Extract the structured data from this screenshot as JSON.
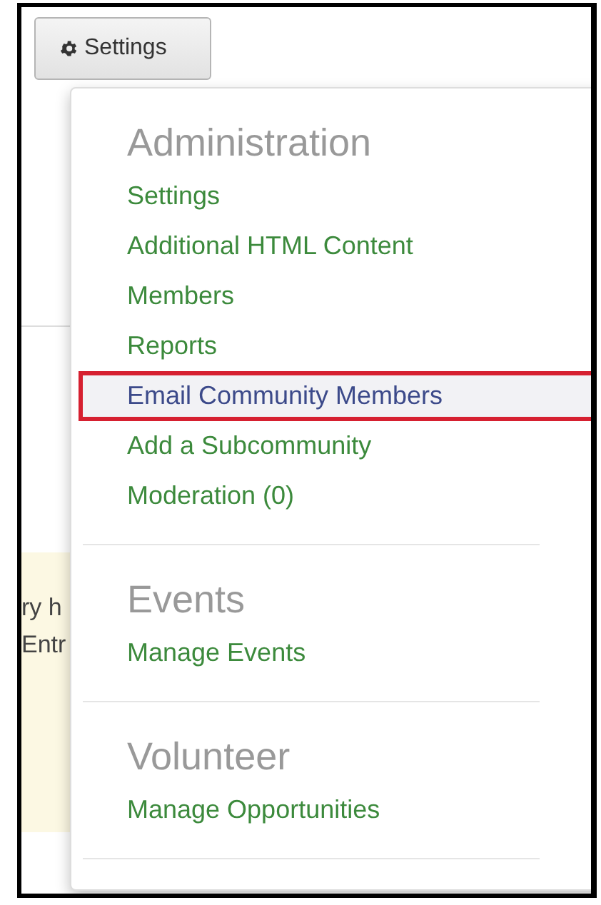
{
  "settings_button": {
    "label": "Settings"
  },
  "background": {
    "notice_lines": [
      "ry h",
      "Entr"
    ]
  },
  "menu": {
    "sections": [
      {
        "title": "Administration",
        "items": [
          {
            "label": "Settings",
            "selected": false,
            "annotated": false
          },
          {
            "label": "Additional HTML Content",
            "selected": false,
            "annotated": false
          },
          {
            "label": "Members",
            "selected": false,
            "annotated": false
          },
          {
            "label": "Reports",
            "selected": false,
            "annotated": false
          },
          {
            "label": "Email Community Members",
            "selected": true,
            "annotated": true
          },
          {
            "label": "Add a Subcommunity",
            "selected": false,
            "annotated": false
          },
          {
            "label": "Moderation (0)",
            "selected": false,
            "annotated": false
          }
        ]
      },
      {
        "title": "Events",
        "items": [
          {
            "label": "Manage Events",
            "selected": false,
            "annotated": false
          }
        ]
      },
      {
        "title": "Volunteer",
        "items": [
          {
            "label": "Manage Opportunities",
            "selected": false,
            "annotated": false
          }
        ]
      }
    ]
  }
}
